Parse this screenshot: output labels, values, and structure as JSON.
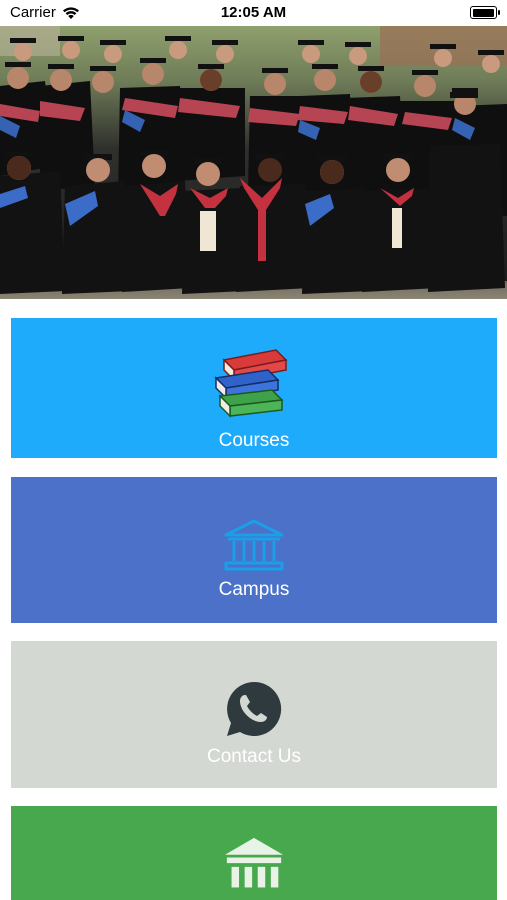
{
  "status_bar": {
    "carrier": "Carrier",
    "time": "12:05 AM",
    "battery_level": 0.9
  },
  "hero": {
    "icon": "graduation-group-photo"
  },
  "tiles": [
    {
      "label": "Courses",
      "icon": "books-icon",
      "color": "#1eabfb"
    },
    {
      "label": "Campus",
      "icon": "building-icon",
      "color": "#4b71c9"
    },
    {
      "label": "Contact Us",
      "icon": "whatsapp-icon",
      "color": "#d4d8d3"
    },
    {
      "label": "",
      "icon": "institution-icon",
      "color": "#47a84d"
    }
  ]
}
